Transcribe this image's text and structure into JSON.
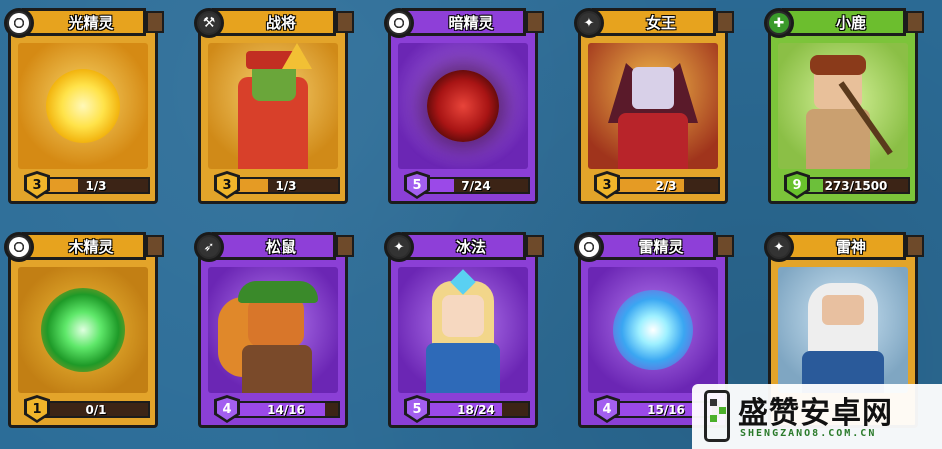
{
  "cards": [
    {
      "name": "光精灵",
      "level": "3",
      "count": "1/3",
      "progress": 0.33,
      "theme": "gold",
      "icon": "pokeball-icon",
      "art": "light-orb"
    },
    {
      "name": "战将",
      "level": "3",
      "count": "1/3",
      "progress": 0.33,
      "theme": "gold",
      "icon": "axe-icon",
      "art": "samurai-warrior"
    },
    {
      "name": "暗精灵",
      "level": "5",
      "count": "7/24",
      "progress": 0.29,
      "theme": "purple",
      "icon": "pokeball-icon",
      "art": "dark-orb"
    },
    {
      "name": "女王",
      "level": "3",
      "count": "2/3",
      "progress": 0.67,
      "theme": "gold",
      "icon": "staff-icon",
      "art": "demon-queen"
    },
    {
      "name": "小鹿",
      "level": "9",
      "count": "273/1500",
      "progress": 0.18,
      "theme": "green",
      "icon": "sparkle-icon",
      "art": "deer-archer"
    },
    {
      "name": "木精灵",
      "level": "1",
      "count": "0/1",
      "progress": 0.0,
      "theme": "gold",
      "icon": "pokeball-icon",
      "art": "wood-orb"
    },
    {
      "name": "松鼠",
      "level": "4",
      "count": "14/16",
      "progress": 0.875,
      "theme": "purple",
      "icon": "bow-icon",
      "art": "squirrel-ranger"
    },
    {
      "name": "冰法",
      "level": "5",
      "count": "18/24",
      "progress": 0.75,
      "theme": "purple",
      "icon": "staff-icon",
      "art": "ice-mage"
    },
    {
      "name": "雷精灵",
      "level": "4",
      "count": "15/16",
      "progress": 0.94,
      "theme": "purple",
      "icon": "pokeball-icon",
      "art": "thunder-orb"
    },
    {
      "name": "雷神",
      "level": "",
      "count": "",
      "progress": 0,
      "theme": "goldblue",
      "icon": "staff-icon",
      "art": "thunder-god"
    }
  ],
  "watermark": {
    "title": "盛赞安卓网",
    "url": "SHENGZANO8.COM.CN"
  }
}
